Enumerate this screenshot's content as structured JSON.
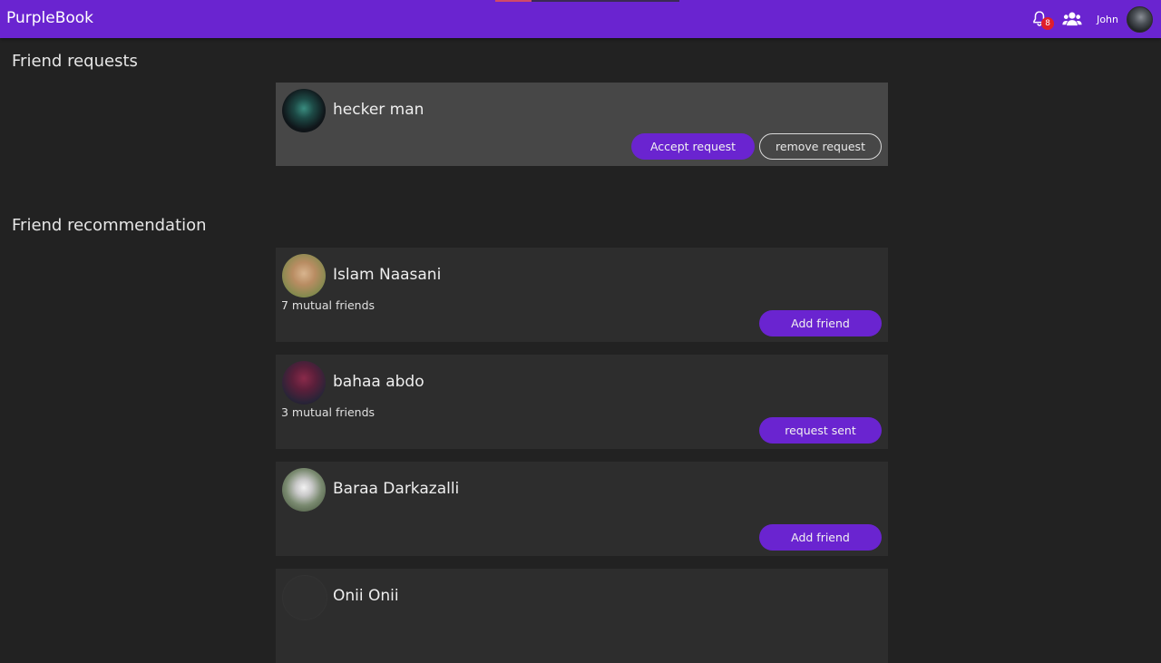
{
  "app": {
    "brand": "PurpleBook",
    "notification_count": "8",
    "username": "John"
  },
  "friend_requests": {
    "heading": "Friend requests",
    "items": [
      {
        "name": "hecker man",
        "accept_label": "Accept request",
        "remove_label": "remove request"
      }
    ]
  },
  "recommendations": {
    "heading": "Friend recommendation",
    "items": [
      {
        "name": "Islam Naasani",
        "mutual": "7 mutual friends",
        "action": "Add friend"
      },
      {
        "name": "bahaa abdo",
        "mutual": "3 mutual friends",
        "action": "request sent"
      },
      {
        "name": "Baraa Darkazalli",
        "mutual": "",
        "action": "Add friend"
      },
      {
        "name": "Onii Onii",
        "mutual": "",
        "action": ""
      }
    ]
  },
  "colors": {
    "brand_purple": "#6a24d0",
    "page_bg": "#222222",
    "request_card_bg": "#474747",
    "rec_card_bg": "#2d2d2d",
    "badge_red": "#e01e2a"
  }
}
